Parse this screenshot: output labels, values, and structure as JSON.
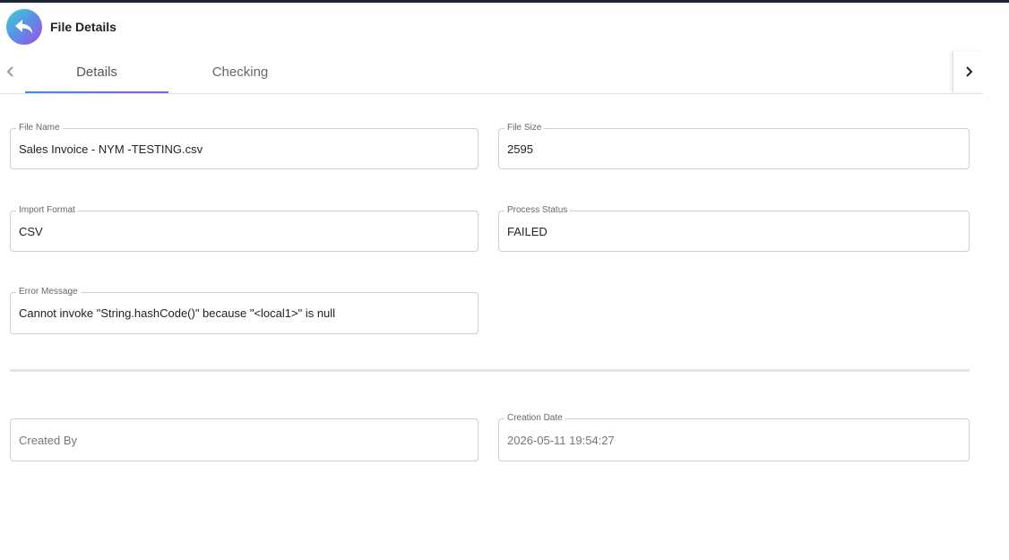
{
  "header": {
    "title": "File Details",
    "back_icon": "reply-arrow-icon",
    "back_gradient": [
      "#3fd0d6",
      "#5b8ee8",
      "#a24fe2"
    ]
  },
  "tabs": [
    {
      "label": "Details",
      "active": true
    },
    {
      "label": "Checking",
      "active": false
    }
  ],
  "fields": {
    "file_name": {
      "label": "File Name",
      "value": "Sales Invoice - NYM -TESTING.csv"
    },
    "file_size": {
      "label": "File Size",
      "value": "2595"
    },
    "import_format": {
      "label": "Import Format",
      "value": "CSV"
    },
    "process_status": {
      "label": "Process Status",
      "value": "FAILED"
    },
    "error_message": {
      "label": "Error Message",
      "value": "Cannot invoke \"String.hashCode()\" because \"<local1>\" is null"
    },
    "created_by": {
      "placeholder": "Created By",
      "value": ""
    },
    "creation_date": {
      "label": "Creation Date",
      "value": "2026-05-11 19:54:27"
    }
  }
}
